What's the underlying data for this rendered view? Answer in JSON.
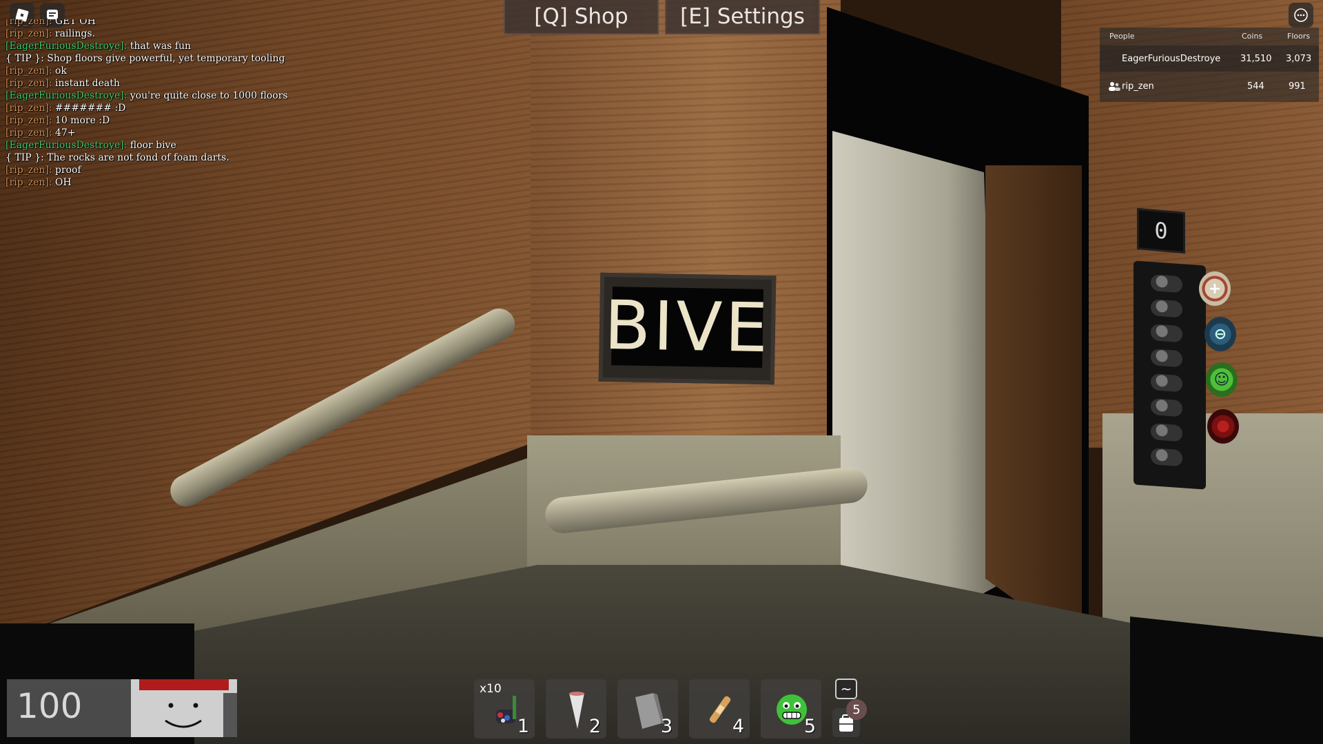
{
  "top_menu": {
    "shop_label": "[Q] Shop",
    "settings_label": "[E] Settings"
  },
  "icons": {
    "roblox_menu": "roblox-logo-icon",
    "chat": "chat-bubble-icon",
    "more": "ellipsis-icon"
  },
  "chat": [
    {
      "name": "[rip_zen]:",
      "name_color": "orange",
      "text": "GET OH"
    },
    {
      "name": "[rip_zen]:",
      "name_color": "orange",
      "text": "railings."
    },
    {
      "name": "[EagerFuriousDestroye]:",
      "name_color": "green",
      "text": "that was fun"
    },
    {
      "name": "",
      "name_color": "white",
      "text": "{ TIP }: Shop floors give powerful, yet temporary tooling"
    },
    {
      "name": "[rip_zen]:",
      "name_color": "orange",
      "text": "ok"
    },
    {
      "name": "[rip_zen]:",
      "name_color": "orange",
      "text": "instant death"
    },
    {
      "name": "[EagerFuriousDestroye]:",
      "name_color": "green",
      "text": "you're quite close to 1000 floors"
    },
    {
      "name": "[rip_zen]:",
      "name_color": "orange",
      "text": "####### :D"
    },
    {
      "name": "[rip_zen]:",
      "name_color": "orange",
      "text": "10 more :D"
    },
    {
      "name": "[rip_zen]:",
      "name_color": "orange",
      "text": "47+"
    },
    {
      "name": "[EagerFuriousDestroye]:",
      "name_color": "green",
      "text": "floor bive"
    },
    {
      "name": "",
      "name_color": "white",
      "text": "{ TIP }: The rocks are not fond of foam darts."
    },
    {
      "name": "[rip_zen]:",
      "name_color": "orange",
      "text": "proof"
    },
    {
      "name": "[rip_zen]:",
      "name_color": "orange",
      "text": "OH"
    }
  ],
  "leaderboard": {
    "headers": {
      "people": "People",
      "coins": "Coins",
      "floors": "Floors"
    },
    "rows": [
      {
        "name": "EagerFuriousDestroye",
        "coins": "31,510",
        "floors": "3,073"
      },
      {
        "name": "rip_zen",
        "coins": "544",
        "floors": "991"
      }
    ]
  },
  "scene": {
    "sign_text": "BIVE",
    "floor_display": "0",
    "elevator_buttons": [
      "plus",
      "minus",
      "smiley",
      "stop"
    ]
  },
  "hud": {
    "health": "100",
    "hotbar": [
      {
        "num": "1",
        "count": "x10",
        "item": "foam-dart-launcher"
      },
      {
        "num": "2",
        "count": "",
        "item": "cone"
      },
      {
        "num": "3",
        "count": "",
        "item": "gray-block"
      },
      {
        "num": "4",
        "count": "",
        "item": "bandage"
      },
      {
        "num": "5",
        "count": "",
        "item": "green-smiley"
      }
    ],
    "tilde_label": "~",
    "backpack_count": "5"
  },
  "colors": {
    "chat_name_orange": "#d4935a",
    "chat_name_green": "#3ecf6d",
    "sign_text": "#ece4c8"
  }
}
